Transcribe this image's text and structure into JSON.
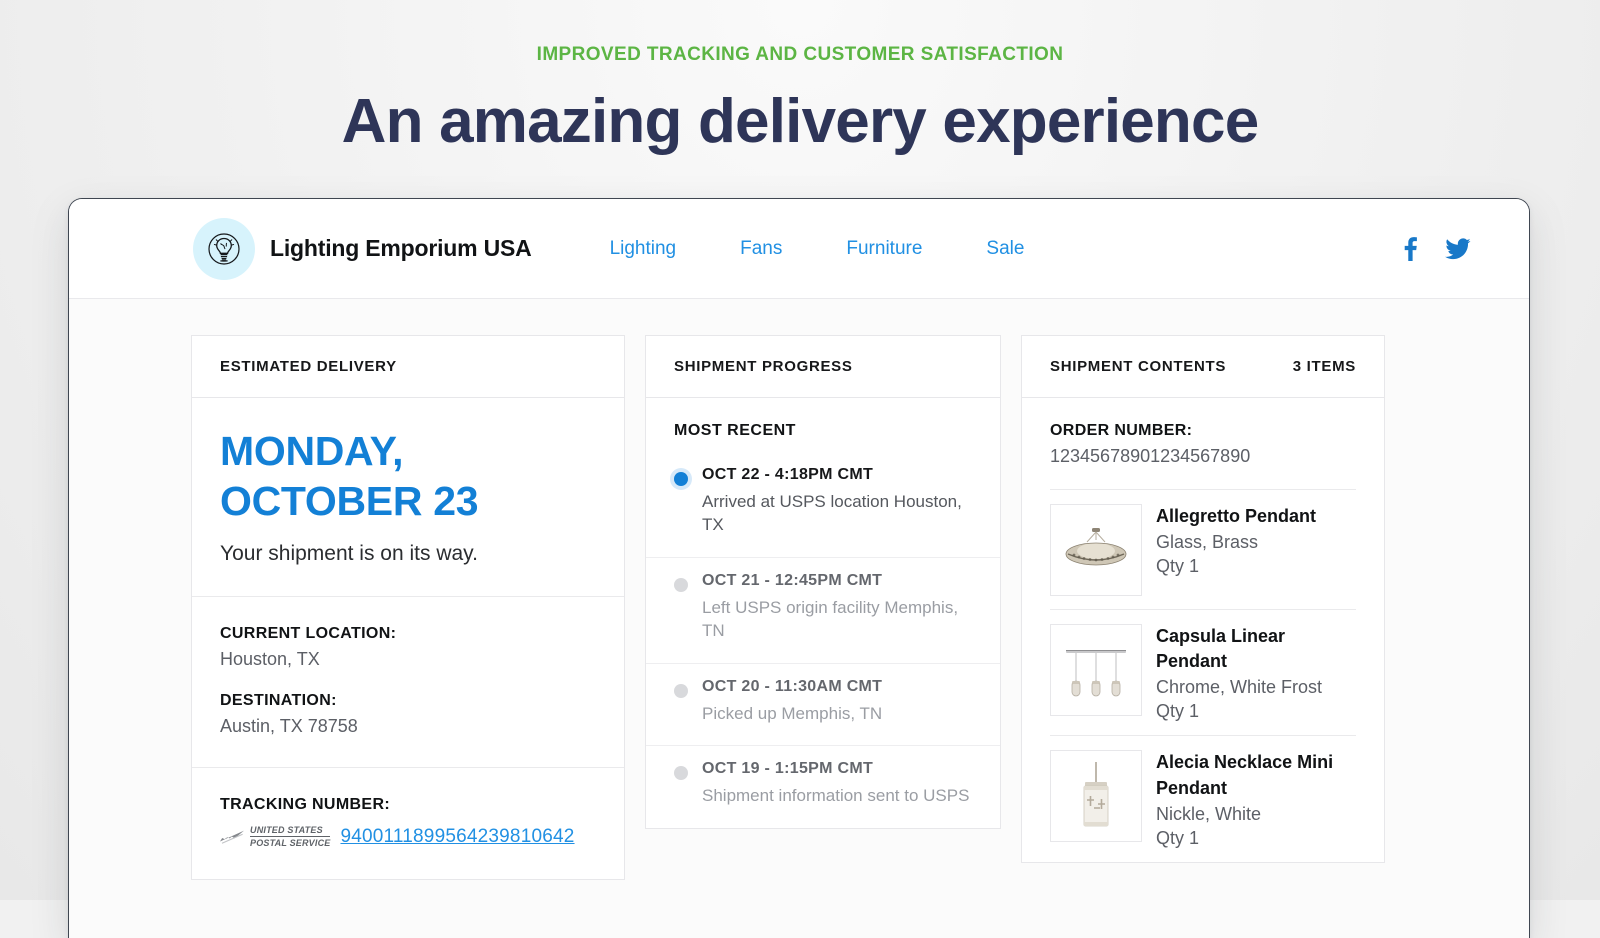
{
  "hero": {
    "eyebrow": "IMPROVED TRACKING AND CUSTOMER SATISFACTION",
    "headline": "An amazing delivery experience",
    "eyebrow_color": "#5cb544",
    "headline_color": "#2e3558"
  },
  "site": {
    "brand_name": "Lighting Emporium USA",
    "logo_icon": "lightbulb-icon",
    "logo_bg_color": "#d7f3fc",
    "nav_link_color": "#2190e3",
    "nav": [
      {
        "label": "Lighting"
      },
      {
        "label": "Fans"
      },
      {
        "label": "Furniture"
      },
      {
        "label": "Sale"
      }
    ],
    "social": [
      {
        "icon": "facebook-icon",
        "label": "Facebook"
      },
      {
        "icon": "twitter-icon",
        "label": "Twitter"
      }
    ]
  },
  "delivery": {
    "panel_title": "ESTIMATED DELIVERY",
    "eta_line1": "MONDAY,",
    "eta_line2": "OCTOBER 23",
    "eta_color": "#1380d6",
    "eta_subtitle": "Your shipment is on its way.",
    "current_location_label": "CURRENT LOCATION:",
    "current_location_value": "Houston, TX",
    "destination_label": "DESTINATION:",
    "destination_value": "Austin, TX 78758",
    "tracking_label": "TRACKING NUMBER:",
    "carrier_icon": "usps-logo-icon",
    "carrier_line1": "UNITED STATES",
    "carrier_line2": "POSTAL SERVICE",
    "tracking_number": "9400111899564239810642"
  },
  "progress": {
    "panel_title": "SHIPMENT PROGRESS",
    "most_recent_label": "MOST RECENT",
    "active_dot_color": "#1380d6",
    "items": [
      {
        "time": "OCT 22 - 4:18PM CMT",
        "description": "Arrived at USPS location Houston, TX",
        "state": "active"
      },
      {
        "time": "OCT 21 - 12:45PM CMT",
        "description": "Left USPS origin facility Memphis, TN",
        "state": "past"
      },
      {
        "time": "OCT 20 - 11:30AM CMT",
        "description": "Picked up Memphis, TN",
        "state": "past"
      },
      {
        "time": "OCT 19 - 1:15PM CMT",
        "description": "Shipment information sent to USPS",
        "state": "past"
      }
    ]
  },
  "contents": {
    "panel_title": "SHIPMENT CONTENTS",
    "item_count_label": "3 ITEMS",
    "order_number_label": "ORDER NUMBER:",
    "order_number": "12345678901234567890",
    "products": [
      {
        "name": "Allegretto Pendant",
        "attributes": "Glass, Brass",
        "qty": "Qty 1",
        "thumb": "pendant-dome-photo"
      },
      {
        "name": "Capsula Linear Pendant",
        "attributes": "Chrome, White Frost",
        "qty": "Qty 1",
        "thumb": "pendant-linear-photo"
      },
      {
        "name": "Alecia Necklace Mini Pendant",
        "attributes": "Nickle, White",
        "qty": "Qty 1",
        "thumb": "pendant-mini-photo"
      }
    ]
  }
}
